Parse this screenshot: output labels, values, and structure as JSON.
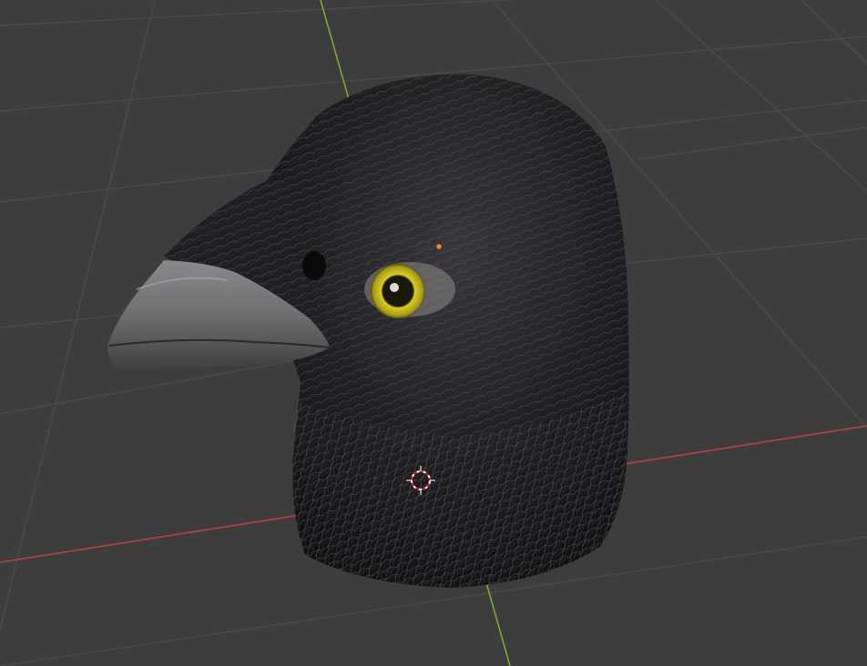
{
  "viewport": {
    "background_color": "#3d3d3d",
    "grid_color": "#4a4a4a",
    "x_axis_color": "#b5414a",
    "y_axis_color": "#7fa834"
  },
  "model": {
    "icon": "crow-head-3d-model",
    "feather_color": "#1b1a1c",
    "beak_color": "#7a797b",
    "eye_iris_color": "#c9be1f"
  },
  "origin_marker": {
    "color": "#f18a2a"
  },
  "cursor_3d": {
    "icon": "3d-cursor-icon",
    "ring_colors": [
      "#ffffff",
      "#cc2222"
    ]
  }
}
